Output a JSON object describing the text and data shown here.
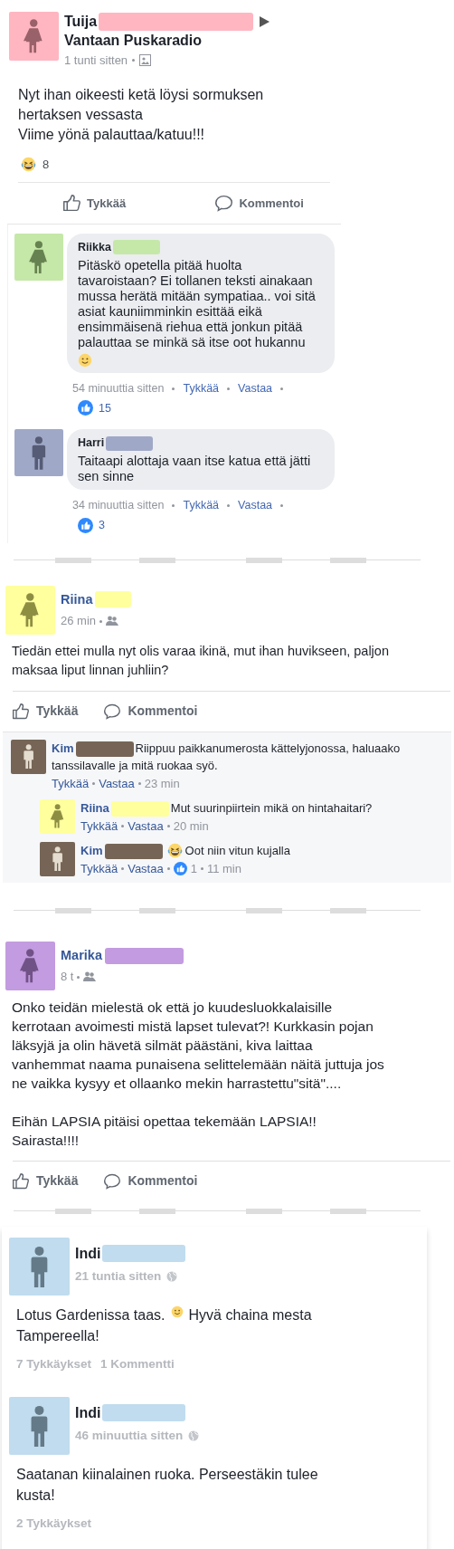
{
  "sections": [
    {
      "kind": "group_post",
      "author": {
        "name": "Tuija",
        "color": "#ffb6c1",
        "kind": "female"
      },
      "group": "Vantaan Puskaradio",
      "time": "1 tunti sitten",
      "body": "Nyt ihan oikeesti ketä löysi sormuksen hertaksen vessasta\nViime yönä palauttaa/katuu!!!",
      "reactions": "8",
      "actions": [
        "Tykkää",
        "Kommentoi"
      ],
      "comments": [
        {
          "author": {
            "name": "Riikka",
            "color": "#c5e8a8",
            "kind": "female"
          },
          "text": [
            {
              "kind": "text",
              "text": "Pitäskö opetella pitää huolta tavaroistaan? Ei tollanen teksti ainakaan mussa herätä mitään sympatiaa.. voi sitä asiat kauniimminkin esittää eikä ensimmäisenä riehua että jonkun pitää palauttaa se minkä sä itse oot hukannu"
            },
            {
              "kind": "smile"
            }
          ],
          "time": "54 minuuttia sitten",
          "links": [
            "Tykkää",
            "Vastaa"
          ],
          "likes": "15"
        },
        {
          "author": {
            "name": "Harri",
            "color": "#a0a8c8",
            "kind": "male"
          },
          "text": [
            {
              "kind": "text",
              "text": "Taitaapi alottaja vaan itse katua että jätti sen sinne"
            }
          ],
          "time": "34 minuuttia sitten",
          "links": [
            "Tykkää",
            "Vastaa"
          ],
          "likes": "3"
        }
      ]
    },
    {
      "kind": "feed_post",
      "author": {
        "name": "Riina",
        "color": "#ffff9e",
        "kind": "female"
      },
      "time": "26 min",
      "body": "Tiedän ettei mulla nyt olis varaa ikinä, mut ihan huvikseen, paljon maksaa liput linnan juhliin?",
      "actions": [
        "Tykkää",
        "Kommentoi"
      ],
      "comments": [
        {
          "author": {
            "name": "Kim",
            "color": "#766556",
            "kind": "male"
          },
          "text": [
            {
              "kind": "text",
              "text": "Riippuu paikkanumerosta kättelyjonossa, haluaako"
            },
            {
              "kind": "break"
            },
            {
              "kind": "text",
              "text": "tanssilavalle ja mitä ruokaa syö."
            }
          ],
          "links": [
            "Tykkää",
            "Vastaa"
          ],
          "time": "23 min",
          "replies": [
            {
              "author": {
                "name": "Riina",
                "color": "#ffff9e",
                "kind": "female"
              },
              "text": [
                {
                  "kind": "text",
                  "text": "Mut suurinpiirtein mikä on hintahaitari?"
                }
              ],
              "links": [
                "Tykkää",
                "Vastaa"
              ],
              "time": "20 min"
            },
            {
              "author": {
                "name": "Kim",
                "color": "#766556",
                "kind": "male"
              },
              "text": [
                {
                  "kind": "laugh"
                },
                {
                  "kind": "text",
                  "text": "Oot niin vitun kujalla"
                }
              ],
              "links": [
                "Tykkää",
                "Vastaa"
              ],
              "likes": "1",
              "time": "11 min"
            }
          ]
        }
      ]
    },
    {
      "kind": "feed_post",
      "author": {
        "name": "Marika",
        "color": "#c39be0",
        "kind": "female"
      },
      "time": "8 t",
      "body": "Onko teidän mielestä ok että jo kuudesluokkalaisille kerrotaan avoimesti mistä lapset tulevat?! Kurkkasin pojan läksyjä ja olin hävetä silmät päästäni, kiva laittaa vanhemmat naama punaisena selittelemään näitä juttuja jos ne vaikka kysyy et ollaanko mekin harrastettu\"sitä\"....\n\nEihän LAPSIA pitäisi opettaa tekemään LAPSIA!!\nSairasta!!!!",
      "actions": [
        "Tykkää",
        "Kommentoi"
      ]
    },
    {
      "kind": "status_list",
      "posts": [
        {
          "author": {
            "name": "Indi",
            "color": "#c0dcee",
            "kind": "male"
          },
          "time": "21 tuntia sitten",
          "body": [
            {
              "kind": "text",
              "text": "Lotus Gardenissa taas."
            },
            {
              "kind": "smile"
            },
            {
              "kind": "text",
              "text": "Hyvä chaina mesta"
            },
            {
              "kind": "break"
            },
            {
              "kind": "text",
              "text": "Tampereella!"
            }
          ],
          "counts": [
            "7 Tykkäykset",
            "1 Kommentti"
          ]
        },
        {
          "author": {
            "name": "Indi",
            "color": "#c0dcee",
            "kind": "male"
          },
          "time": "46 minuuttia sitten",
          "body": [
            {
              "kind": "text",
              "text": "Saatanan kiinalainen ruoka. Perseestäkin tulee"
            },
            {
              "kind": "break"
            },
            {
              "kind": "text",
              "text": "kusta!"
            }
          ],
          "counts": [
            "2 Tykkäykset"
          ]
        }
      ]
    }
  ]
}
